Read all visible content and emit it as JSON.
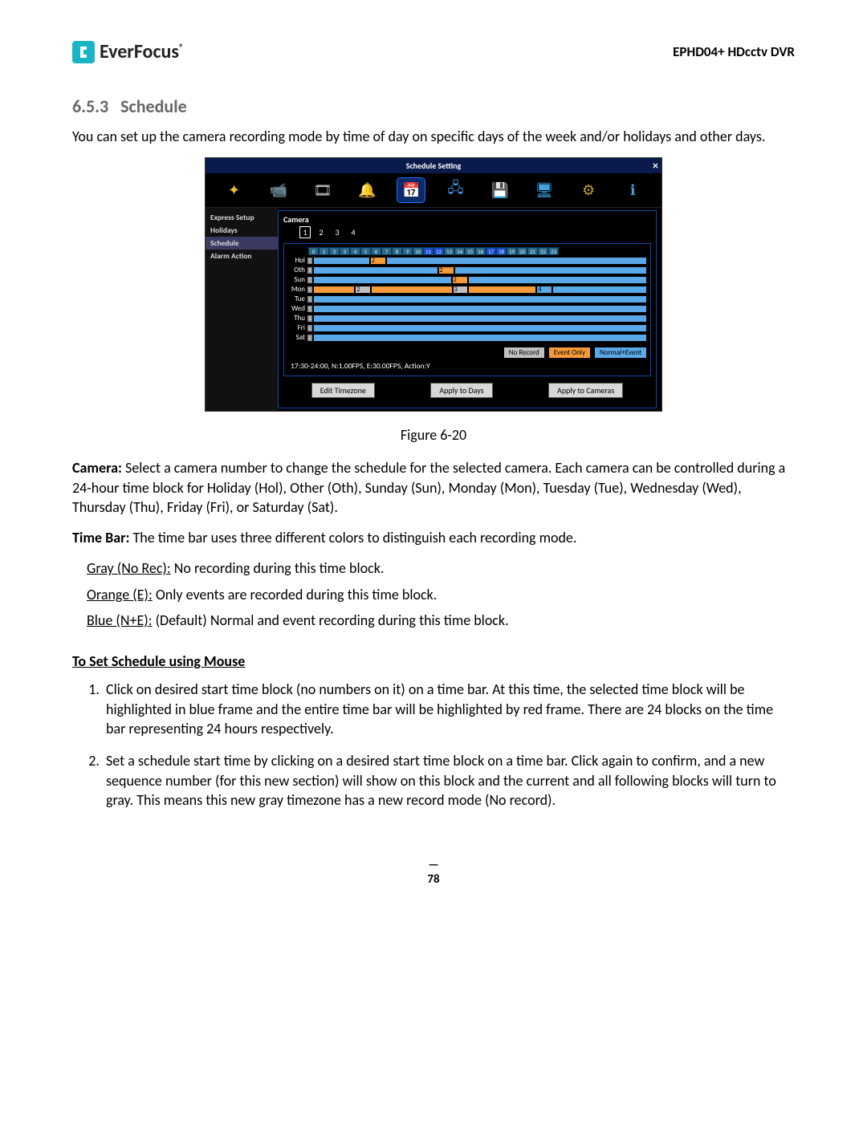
{
  "header": {
    "brand": "EverFocus",
    "doc_title": "EPHD04+  HDcctv DVR"
  },
  "section": {
    "number": "6.5.3",
    "title": "Schedule",
    "intro": "You can set up the camera recording mode by time of day on specific days of the week and/or holidays and other days."
  },
  "dvr": {
    "title": "Schedule Setting",
    "close": "×",
    "sidebar": [
      "Express Setup",
      "Holidays",
      "Schedule",
      "Alarm Action"
    ],
    "camera_label": "Camera",
    "camera_tabs": [
      "1",
      "2",
      "3",
      "4"
    ],
    "hours": [
      "0",
      "1",
      "2",
      "3",
      "4",
      "5",
      "6",
      "7",
      "8",
      "9",
      "10",
      "11",
      "12",
      "13",
      "14",
      "15",
      "16",
      "17",
      "18",
      "19",
      "20",
      "21",
      "22",
      "23"
    ],
    "days": [
      "Hol",
      "Oth",
      "Sun",
      "Mon",
      "Tue",
      "Wed",
      "Thu",
      "Fri",
      "Sat"
    ],
    "legend": {
      "no_record": "No Record",
      "event_only": "Event Only",
      "normal_event": "Normal+Event"
    },
    "status": "17:30-24:00, N:1.00FPS, E:30.00FPS, Action:Y",
    "buttons": {
      "edit": "Edit Timezone",
      "apply_days": "Apply to Days",
      "apply_cams": "Apply to Cameras"
    }
  },
  "figure_caption": "Figure 6-20",
  "para_camera": {
    "label": "Camera:",
    "text": " Select a camera number to change the schedule for the selected camera. Each camera can be controlled during a 24-hour time block for Holiday (Hol), Other (Oth), Sunday (Sun), Monday (Mon), Tuesday (Tue), Wednesday (Wed), Thursday (Thu), Friday (Fri), or Saturday (Sat)."
  },
  "para_timebar": {
    "label": "Time Bar:",
    "text": " The time bar uses three different colors to distinguish each recording mode."
  },
  "bullets": {
    "gray_label": "Gray (No Rec):",
    "gray_text": " No recording during this time block.",
    "orange_label": "Orange (E):",
    "orange_text": " Only events are recorded during this time block.",
    "blue_label": "Blue (N+E):",
    "blue_text": " (Default) Normal and event recording during this time block."
  },
  "subhead": "To Set Schedule using Mouse",
  "steps": [
    "Click on desired start time block (no numbers on it) on a time bar. At this time, the selected time block will be highlighted in blue frame and the entire time bar will be highlighted by red frame. There are 24 blocks on the time bar representing 24 hours respectively.",
    "Set a schedule start time by clicking on a desired start time block on a time bar.  Click again to confirm, and a new sequence number (for this new section) will show on this block and the current and all following blocks will turn to gray. This means this new gray timezone has a new record mode (No record)."
  ],
  "page": "78"
}
